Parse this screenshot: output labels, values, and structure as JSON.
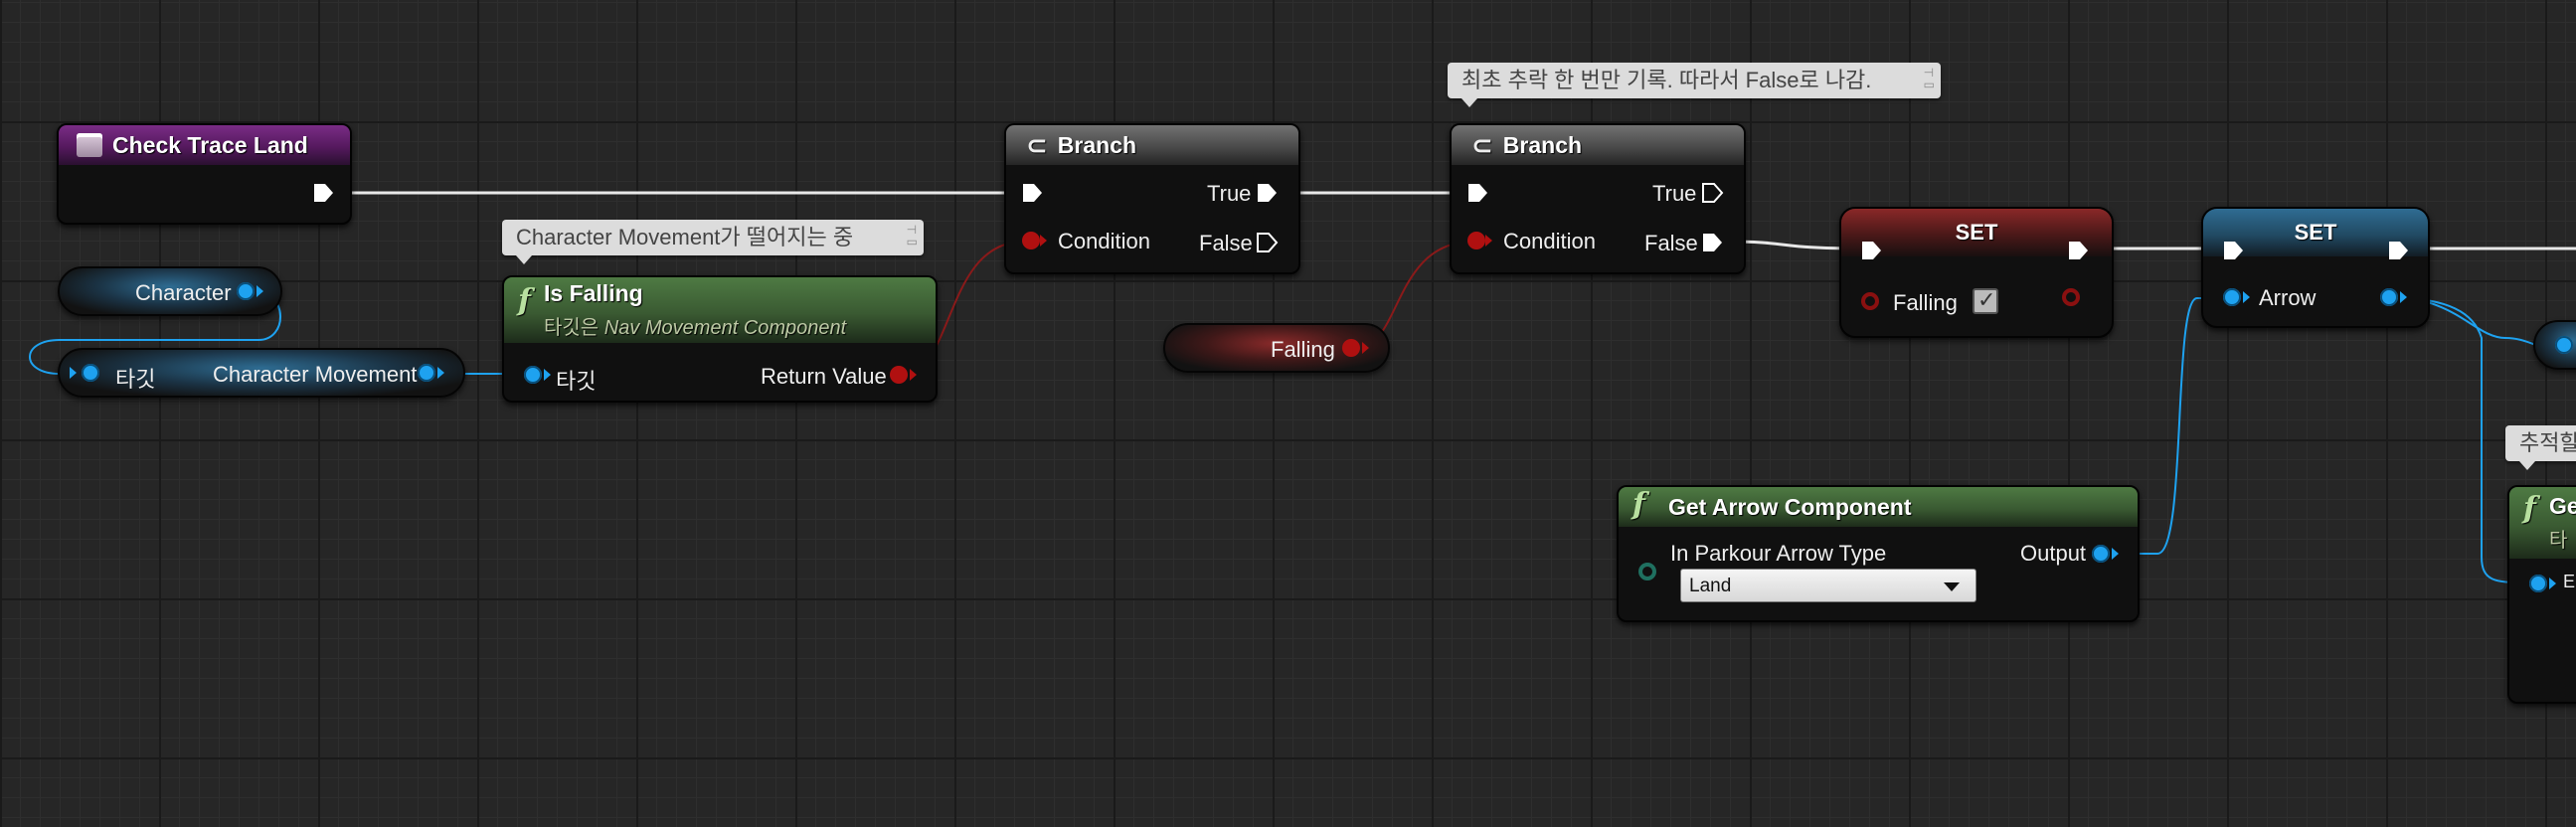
{
  "comments": {
    "branch2_comment": "최초 추락 한 번만 기록. 따라서 False로 나감.",
    "is_falling_comment": "Character Movement가 떨어지는 중",
    "right_cut_comment": "추적할"
  },
  "nodes": {
    "check_trace_land": {
      "title": "Check Trace Land"
    },
    "character_var": {
      "label": "Character"
    },
    "character_movement": {
      "target_label": "타깃",
      "output_label": "Character Movement"
    },
    "is_falling": {
      "title": "Is Falling",
      "subtitle_prefix": "타깃은",
      "subtitle_class": "Nav Movement Component",
      "target_label": "타깃",
      "return_label": "Return Value"
    },
    "branch1": {
      "title": "Branch",
      "true_label": "True",
      "false_label": "False",
      "condition_label": "Condition"
    },
    "branch2": {
      "title": "Branch",
      "true_label": "True",
      "false_label": "False",
      "condition_label": "Condition"
    },
    "falling_var": {
      "label": "Falling"
    },
    "set_falling": {
      "title": "SET",
      "var_label": "Falling",
      "checked": true
    },
    "set_arrow": {
      "title": "SET",
      "var_label": "Arrow"
    },
    "get_arrow_component": {
      "title": "Get Arrow Component",
      "input_label": "In Parkour Arrow Type",
      "output_label": "Output",
      "dropdown_value": "Land"
    },
    "right_node": {
      "title": "Ge",
      "sub": "타",
      "pin": "E"
    }
  },
  "colors": {
    "exec": "#ffffff",
    "object_pin": "#1ea2f0",
    "bool_pin": "#b01010",
    "function_header": "#3a5a32",
    "event_header": "#55195e"
  }
}
